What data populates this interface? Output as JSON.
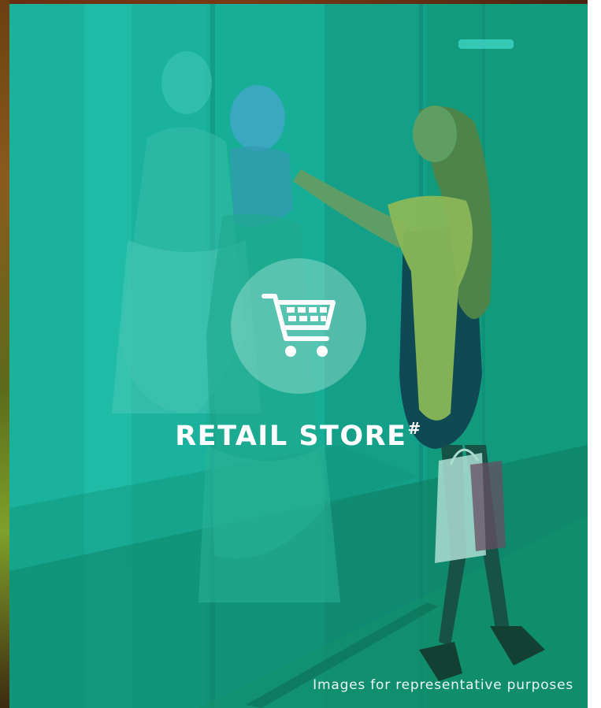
{
  "banner": {
    "title": "RETAIL STORE",
    "title_marker": "#",
    "disclaimer": "Images for representative purposes",
    "icon": "shopping-cart-icon",
    "overlay_color": "#1cae95"
  }
}
